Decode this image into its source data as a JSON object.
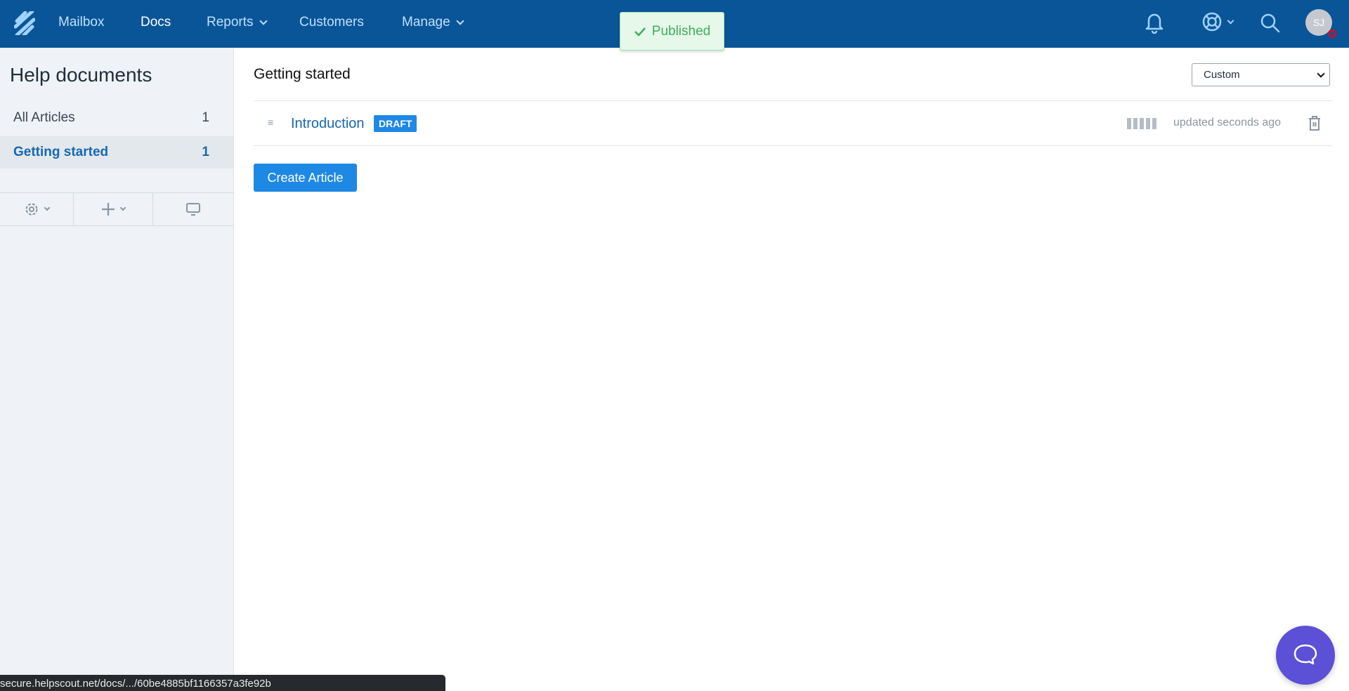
{
  "nav": {
    "items": [
      {
        "label": "Mailbox",
        "active": false,
        "dropdown": false
      },
      {
        "label": "Docs",
        "active": true,
        "dropdown": false
      },
      {
        "label": "Reports",
        "active": false,
        "dropdown": true
      },
      {
        "label": "Customers",
        "active": false,
        "dropdown": false
      },
      {
        "label": "Manage",
        "active": false,
        "dropdown": true
      }
    ],
    "avatar_initials": "SJ",
    "icons": [
      "bell-icon",
      "lifebuoy-icon",
      "search-icon"
    ]
  },
  "toast": {
    "text": "Published",
    "color": "#3fae5a"
  },
  "sidebar": {
    "title": "Help documents",
    "items": [
      {
        "label": "All Articles",
        "count": "1"
      },
      {
        "label": "Getting started",
        "count": "1",
        "selected": true
      }
    ]
  },
  "main": {
    "title": "Getting started",
    "sort_select": "Custom",
    "articles": [
      {
        "title": "Introduction",
        "badge": "DRAFT",
        "updated": "updated seconds ago"
      }
    ],
    "create_label": "Create Article"
  },
  "status_url": "secure.helpscout.net/docs/.../60be4885bf1166357a3fe92b",
  "colors": {
    "nav": "#0a5597",
    "accent": "#1e88e5",
    "chat": "#5b50d6"
  }
}
